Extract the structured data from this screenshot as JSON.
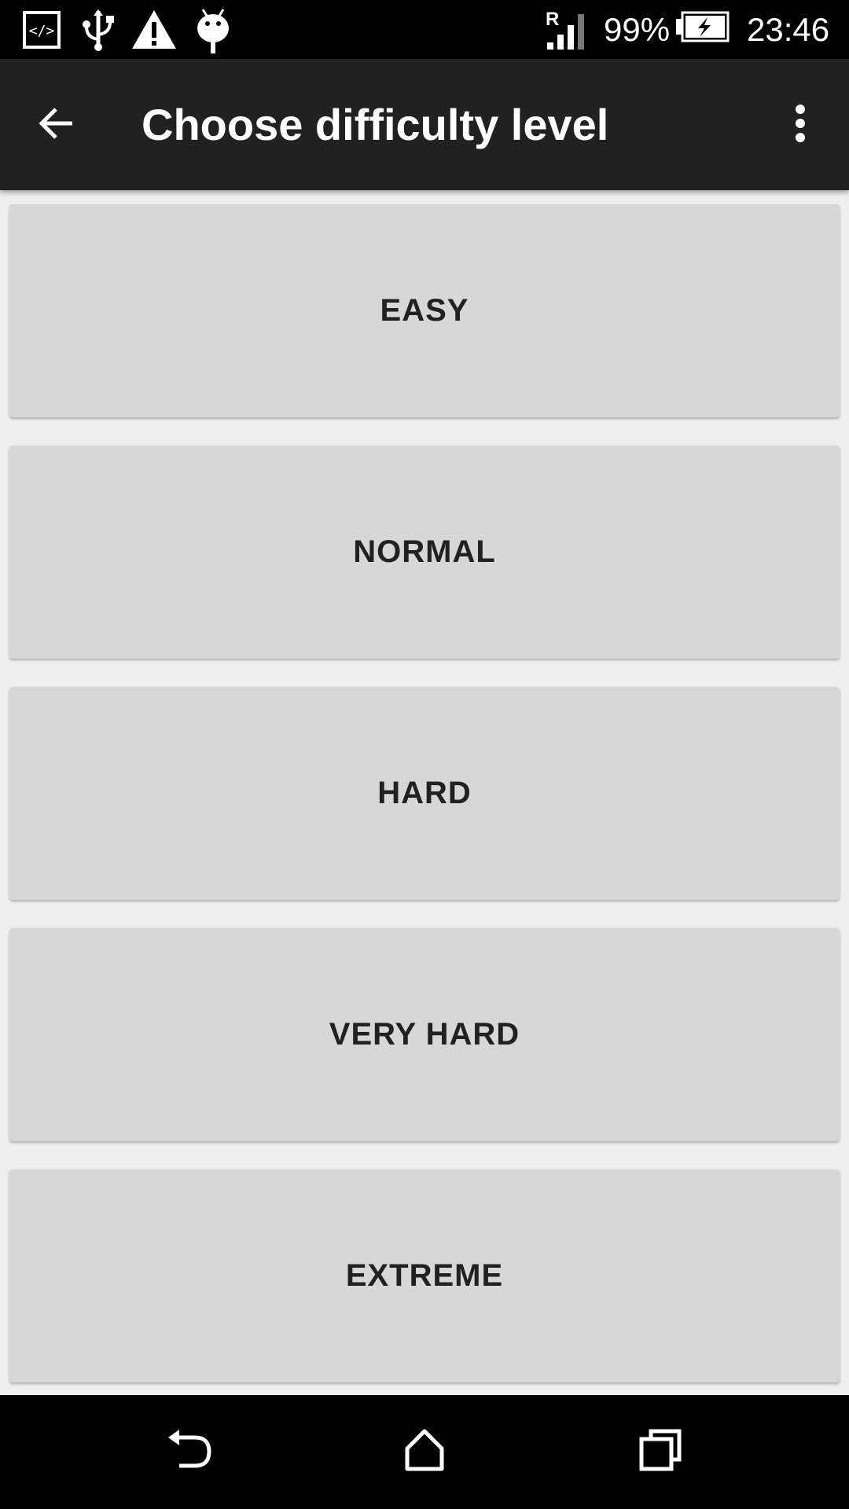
{
  "status_bar": {
    "battery_percent": "99%",
    "time": "23:46",
    "icons": [
      "developer-code-icon",
      "usb-icon",
      "warning-icon",
      "android-debug-icon",
      "signal-roaming-icon",
      "battery-charging-icon"
    ],
    "signal_roaming_label": "R"
  },
  "app_bar": {
    "title": "Choose difficulty level",
    "back_icon": "arrow-back-icon",
    "menu_icon": "more-vert-icon"
  },
  "levels": [
    {
      "label": "EASY"
    },
    {
      "label": "NORMAL"
    },
    {
      "label": "HARD"
    },
    {
      "label": "VERY HARD"
    },
    {
      "label": "EXTREME"
    }
  ],
  "nav_bar": {
    "icons": [
      "nav-back-icon",
      "nav-home-icon",
      "nav-recents-icon"
    ]
  },
  "colors": {
    "status_bar_bg": "#000000",
    "app_bar_bg": "#212121",
    "content_bg": "#efefef",
    "button_bg": "#d6d7d7",
    "button_text": "#212121"
  }
}
